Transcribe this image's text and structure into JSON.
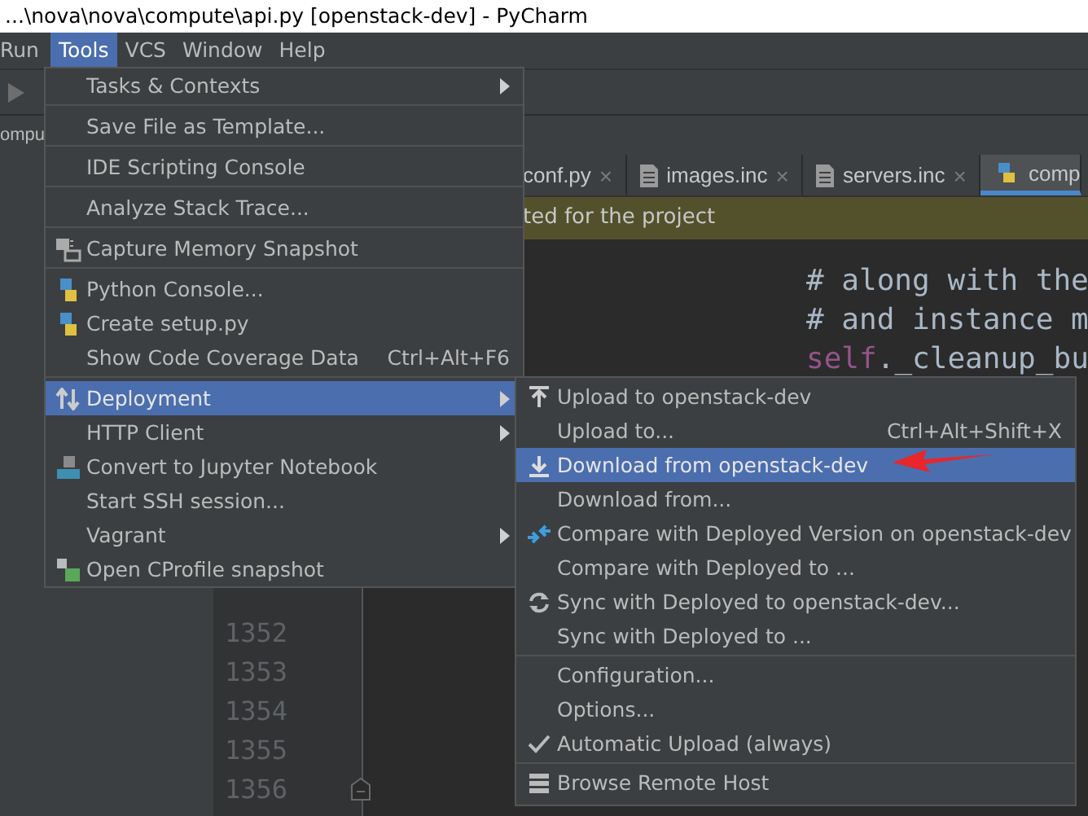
{
  "window": {
    "title": "...\\nova\\nova\\compute\\api.py [openstack-dev] - PyCharm"
  },
  "menubar": [
    {
      "label": "Run",
      "selected": false
    },
    {
      "label": "Tools",
      "selected": true
    },
    {
      "label": "VCS",
      "selected": false
    },
    {
      "label": "Window",
      "selected": false
    },
    {
      "label": "Help",
      "selected": false
    }
  ],
  "navigation": {
    "crumb": "ompu"
  },
  "tabs": [
    {
      "label": "conf.py",
      "kind": "plain",
      "close": "×",
      "selected": false
    },
    {
      "label": "images.inc",
      "kind": "file",
      "close": "×",
      "selected": false
    },
    {
      "label": "servers.inc",
      "kind": "file",
      "close": "×",
      "selected": false
    },
    {
      "label": "comp",
      "kind": "python",
      "selected": true
    }
  ],
  "notification": {
    "text": "ted for the project"
  },
  "editor": {
    "rows": [
      {},
      {
        "code": [
          {
            "kind": "comment",
            "text": "# along with the"
          }
        ]
      },
      {
        "code": [
          {
            "kind": "comment",
            "text": "# and instance m"
          }
        ]
      },
      {
        "code": [
          {
            "kind": "self",
            "text": "self"
          },
          {
            "kind": "plain",
            "text": "._cleanup_bu"
          }
        ]
      },
      {},
      {},
      {},
      {},
      {},
      {},
      {
        "number": "1352"
      },
      {
        "number": "1353"
      },
      {
        "number": "1354"
      },
      {
        "number": "1355"
      },
      {
        "number": "1356",
        "fold": true
      }
    ]
  },
  "tools_menu": [
    {
      "kind": "plain",
      "label": "Tasks & Contexts",
      "submenu": true,
      "selected": false
    },
    {
      "kind": "separator"
    },
    {
      "kind": "plain",
      "label": "Save File as Template...",
      "submenu": false,
      "selected": false
    },
    {
      "kind": "separator"
    },
    {
      "kind": "plain",
      "label": "IDE Scripting Console",
      "submenu": false,
      "selected": false
    },
    {
      "kind": "separator"
    },
    {
      "kind": "plain",
      "label": "Analyze Stack Trace...",
      "submenu": false,
      "selected": false
    },
    {
      "kind": "separator"
    },
    {
      "kind": "capture",
      "label": "Capture Memory Snapshot",
      "submenu": false,
      "selected": false
    },
    {
      "kind": "separator"
    },
    {
      "kind": "python",
      "label": "Python Console...",
      "submenu": false,
      "selected": false
    },
    {
      "kind": "setup",
      "label": "Create setup.py",
      "submenu": false,
      "selected": false
    },
    {
      "kind": "plain",
      "label": "Show Code Coverage Data",
      "shortcut": "Ctrl+Alt+F6",
      "submenu": false,
      "selected": false
    },
    {
      "kind": "separator"
    },
    {
      "kind": "deploy",
      "label": "Deployment",
      "submenu": true,
      "selected": true
    },
    {
      "kind": "plain",
      "label": "HTTP Client",
      "submenu": true,
      "selected": false
    },
    {
      "kind": "jupyter",
      "label": "Convert to Jupyter Notebook",
      "submenu": false,
      "selected": false
    },
    {
      "kind": "plain",
      "label": "Start SSH session...",
      "submenu": false,
      "selected": false
    },
    {
      "kind": "plain",
      "label": "Vagrant",
      "submenu": true,
      "selected": false
    },
    {
      "kind": "cprofile",
      "label": "Open CProfile snapshot",
      "submenu": false,
      "selected": false
    }
  ],
  "deployment_menu": [
    {
      "kind": "upload",
      "label": "Upload to openstack-dev",
      "selected": false
    },
    {
      "kind": "plain",
      "label": "Upload to...",
      "shortcut": "Ctrl+Alt+Shift+X",
      "selected": false
    },
    {
      "kind": "download",
      "label": "Download from openstack-dev",
      "selected": true
    },
    {
      "kind": "plain",
      "label": "Download from...",
      "selected": false
    },
    {
      "kind": "compare",
      "label": "Compare with Deployed Version on openstack-dev",
      "selected": false
    },
    {
      "kind": "plain",
      "label": "Compare with Deployed to ...",
      "selected": false
    },
    {
      "kind": "sync",
      "label": "Sync with Deployed to openstack-dev...",
      "selected": false
    },
    {
      "kind": "plain",
      "label": "Sync with Deployed to ...",
      "selected": false
    },
    {
      "kind": "separator"
    },
    {
      "kind": "plain",
      "label": "Configuration...",
      "selected": false
    },
    {
      "kind": "plain",
      "label": "Options...",
      "selected": false
    },
    {
      "kind": "toggle",
      "label": "Automatic Upload (always)",
      "checked": true,
      "selected": false
    },
    {
      "kind": "separator"
    },
    {
      "kind": "server",
      "label": "Browse Remote Host",
      "selected": false
    }
  ]
}
